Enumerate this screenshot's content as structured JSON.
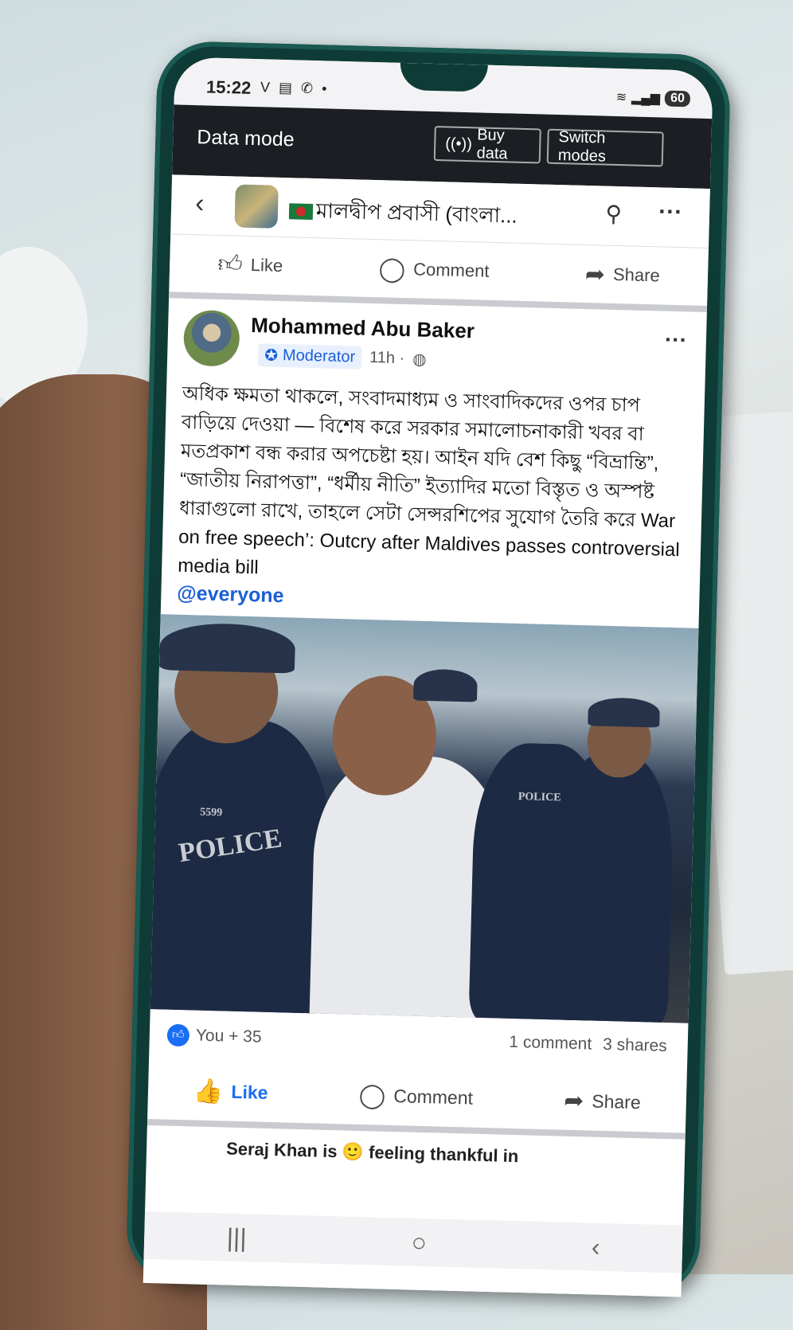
{
  "status_bar": {
    "time": "15:22",
    "notification_icons": "V ▤ ✆ •",
    "battery": "60"
  },
  "data_banner": {
    "label": "Data mode",
    "buy_data": "Buy data",
    "switch_modes": "Switch modes"
  },
  "group_header": {
    "title": "মালদ্বীপ প্রবাসী (বাংলা..."
  },
  "top_actions": {
    "like": "Like",
    "comment": "Comment",
    "share": "Share"
  },
  "post": {
    "author": "Mohammed Abu Baker",
    "role": "Moderator",
    "time": "11h ·",
    "body": "অধিক ক্ষমতা থাকলে, সংবাদমাধ্যম ও সাংবাদিকদের ওপর চাপ বাড়িয়ে দেওয়া — বিশেষ করে সরকার সমালোচনাকারী খবর বা মতপ্রকাশ বন্ধ করার অপচেষ্টা হয়। আইন যদি বেশ কিছু “বিভ্রান্তি”, “জাতীয় নিরাপত্তা”, “ধর্মীয় নীতি” ইত্যাদির মতো বিস্তৃত ও অস্পষ্ট ধারাগুলো রাখে, তাহলে সেটা সেন্সরশিপের সুযোগ তৈরি করে War on free speech’: Outcry after Maldives passes controversial media bill",
    "mention": "@everyone",
    "photo_text": {
      "police": "POLICE",
      "badge_no": "5599",
      "police_small": "POLICE"
    }
  },
  "reactions": {
    "likes": "You + 35",
    "comments": "1 comment",
    "shares": "3 shares"
  },
  "bottom_actions": {
    "like": "Like",
    "comment": "Comment",
    "share": "Share"
  },
  "next_post": {
    "preview": "Seraj Khan is 🙂 feeling thankful in"
  },
  "nav": {
    "recents": "|||",
    "home": "○",
    "back": "‹"
  },
  "colors": {
    "accent": "#1a6ef5",
    "banner": "#1b1e23",
    "phone_body": "#0f3b36"
  }
}
